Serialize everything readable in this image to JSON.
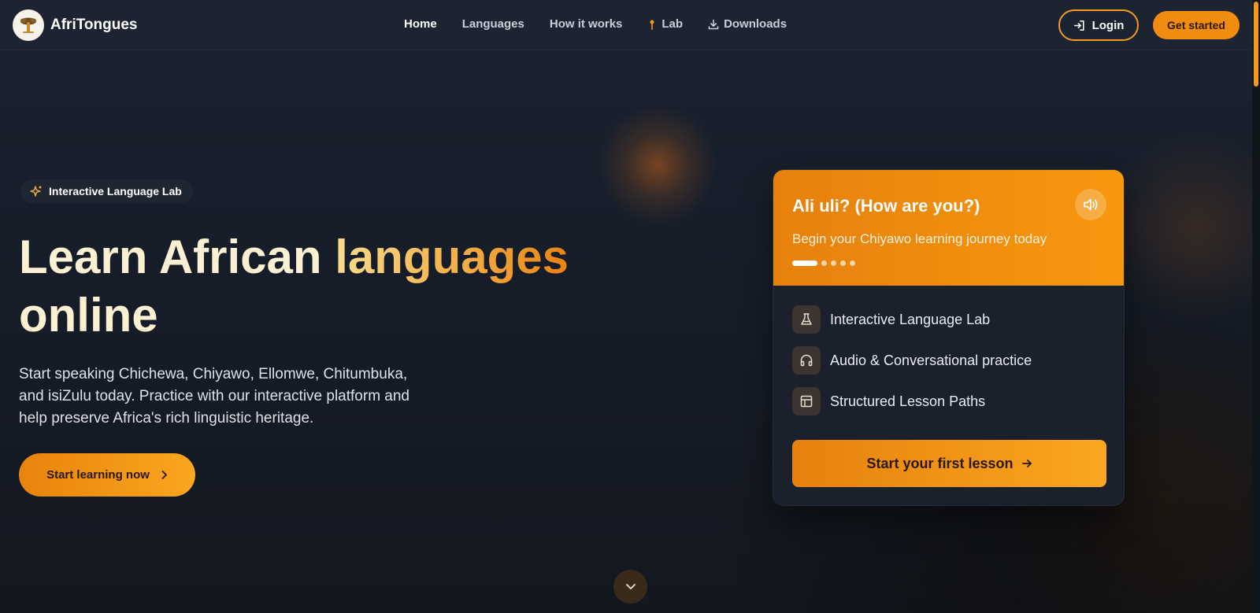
{
  "brand": {
    "name": "AfriTongues",
    "logo_icon": "baobab-tree-icon"
  },
  "nav": {
    "home": "Home",
    "languages": "Languages",
    "how_it_works": "How it works",
    "lab": "Lab",
    "downloads": "Downloads"
  },
  "auth": {
    "login": "Login",
    "get_started": "Get started"
  },
  "hero": {
    "tag": "Interactive Language Lab",
    "title_part1": "Learn African ",
    "title_accent": "languages",
    "title_part2": "online",
    "subtitle": "Start speaking Chichewa, Chiyawo, Ellomwe, Chitumbuka, and isiZulu today. Practice with our interactive platform and help preserve Africa's rich linguistic heritage.",
    "cta": "Start learning now"
  },
  "card": {
    "phrase": "Ali uli? (How are you?)",
    "tagline": "Begin your Chiyawo learning journey today",
    "slides_total": 5,
    "slide_active": 1,
    "features": [
      {
        "label": "Interactive Language Lab",
        "icon": "flask-icon"
      },
      {
        "label": "Audio & Conversational practice",
        "icon": "headphones-icon"
      },
      {
        "label": "Structured Lesson Paths",
        "icon": "layout-icon"
      }
    ],
    "cta": "Start your first lesson"
  },
  "colors": {
    "accent": "#f39a1e",
    "accent_dark": "#e6810d",
    "background": "#161c27",
    "navbar": "#1d2431",
    "card": "#1a202c"
  }
}
